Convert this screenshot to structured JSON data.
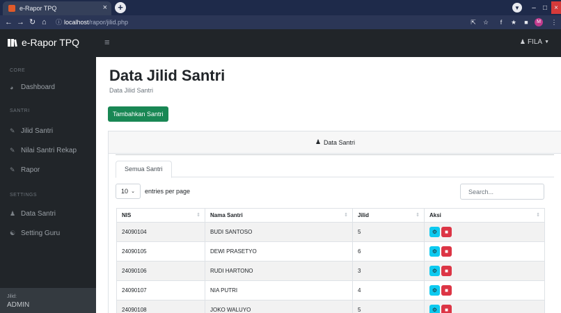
{
  "browser": {
    "tab_title": "e-Rapor TPQ",
    "tab_close": "×",
    "new_tab": "+",
    "url_host": "localhost",
    "url_path": "/rapor/jilid.php"
  },
  "navbar": {
    "brand": "e-Rapor TPQ",
    "user": "FILA"
  },
  "sidebar": {
    "sections": [
      {
        "heading": "CORE",
        "items": [
          {
            "label": "Dashboard",
            "icon": "gauge-icon"
          }
        ]
      },
      {
        "heading": "SANTRI",
        "items": [
          {
            "label": "Jilid Santri",
            "icon": "edit-icon"
          },
          {
            "label": "Nilai Santri Rekap",
            "icon": "edit-icon"
          },
          {
            "label": "Rapor",
            "icon": "edit-icon"
          }
        ]
      },
      {
        "heading": "SETTINGS",
        "items": [
          {
            "label": "Data Santri",
            "icon": "user-tie-icon"
          },
          {
            "label": "Setting Guru",
            "icon": "users-icon"
          }
        ]
      }
    ],
    "footer_label": "Jilid:",
    "footer_user": "ADMIN"
  },
  "main": {
    "title": "Data Jilid Santri",
    "subtitle": "Data Jilid Santri",
    "add_button": "Tambahkan Santri",
    "card_header": "Data Santri",
    "tab": "Semua Santri",
    "entries_value": "10",
    "entries_label": "entries per page",
    "search_placeholder": "Search...",
    "columns": [
      "NIS",
      "Nama Santri",
      "Jilid",
      "Aksi"
    ],
    "rows": [
      {
        "nis": "24090104",
        "nama": "BUDI SANTOSO",
        "jilid": "5"
      },
      {
        "nis": "24090105",
        "nama": "DEWI PRASETYO",
        "jilid": "6"
      },
      {
        "nis": "24090106",
        "nama": "RUDI HARTONO",
        "jilid": "3"
      },
      {
        "nis": "24090107",
        "nama": "NIA PUTRI",
        "jilid": "4"
      },
      {
        "nis": "24090108",
        "nama": "JOKO WALUYO",
        "jilid": "5"
      }
    ]
  },
  "colors": {
    "navbar": "#212529",
    "add_button": "#198754",
    "edit_button": "#0dcaf0",
    "delete_button": "#dc3545"
  }
}
